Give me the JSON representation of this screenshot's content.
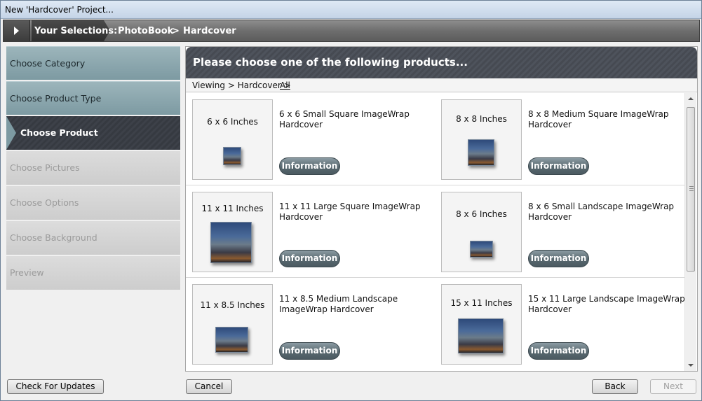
{
  "window": {
    "title": "New 'Hardcover' Project..."
  },
  "breadcrumb": {
    "label": "Your Selections:",
    "items": [
      "PhotoBook",
      "Hardcover"
    ],
    "separator": ">"
  },
  "steps": [
    {
      "label": "Choose Category",
      "state": "done"
    },
    {
      "label": "Choose Product Type",
      "state": "done"
    },
    {
      "label": "Choose Product",
      "state": "current"
    },
    {
      "label": "Choose Pictures",
      "state": "todo"
    },
    {
      "label": "Choose Options",
      "state": "todo"
    },
    {
      "label": "Choose Background",
      "state": "todo"
    },
    {
      "label": "Preview",
      "state": "todo"
    }
  ],
  "panel": {
    "heading": "Please choose one of the following products...",
    "viewing_prefix": "Viewing > Hardcover >",
    "viewing_link": "All"
  },
  "products": [
    {
      "size": "6 x 6 Inches",
      "title": "6 x 6 Small Square ImageWrap Hardcover",
      "button": "Information"
    },
    {
      "size": "8 x 8 Inches",
      "title": "8 x 8 Medium Square ImageWrap Hardcover",
      "button": "Information"
    },
    {
      "size": "11 x 11 Inches",
      "title": "11 x 11 Large Square ImageWrap Hardcover",
      "button": "Information"
    },
    {
      "size": "8 x 6 Inches",
      "title": "8 x 6 Small Landscape ImageWrap Hardcover",
      "button": "Information"
    },
    {
      "size": "11 x 8.5 Inches",
      "title": "11 x 8.5 Medium Landscape ImageWrap Hardcover",
      "button": "Information"
    },
    {
      "size": "15 x 11 Inches",
      "title": "15 x 11 Large Landscape ImageWrap Hardcover",
      "button": "Information"
    }
  ],
  "footer": {
    "check_updates": "Check For Updates",
    "cancel": "Cancel",
    "back": "Back",
    "next": "Next"
  },
  "colors": {
    "accent_dark": "#3d4149",
    "step_done": "#8aa6ad",
    "info_button": "#5b6b72"
  }
}
